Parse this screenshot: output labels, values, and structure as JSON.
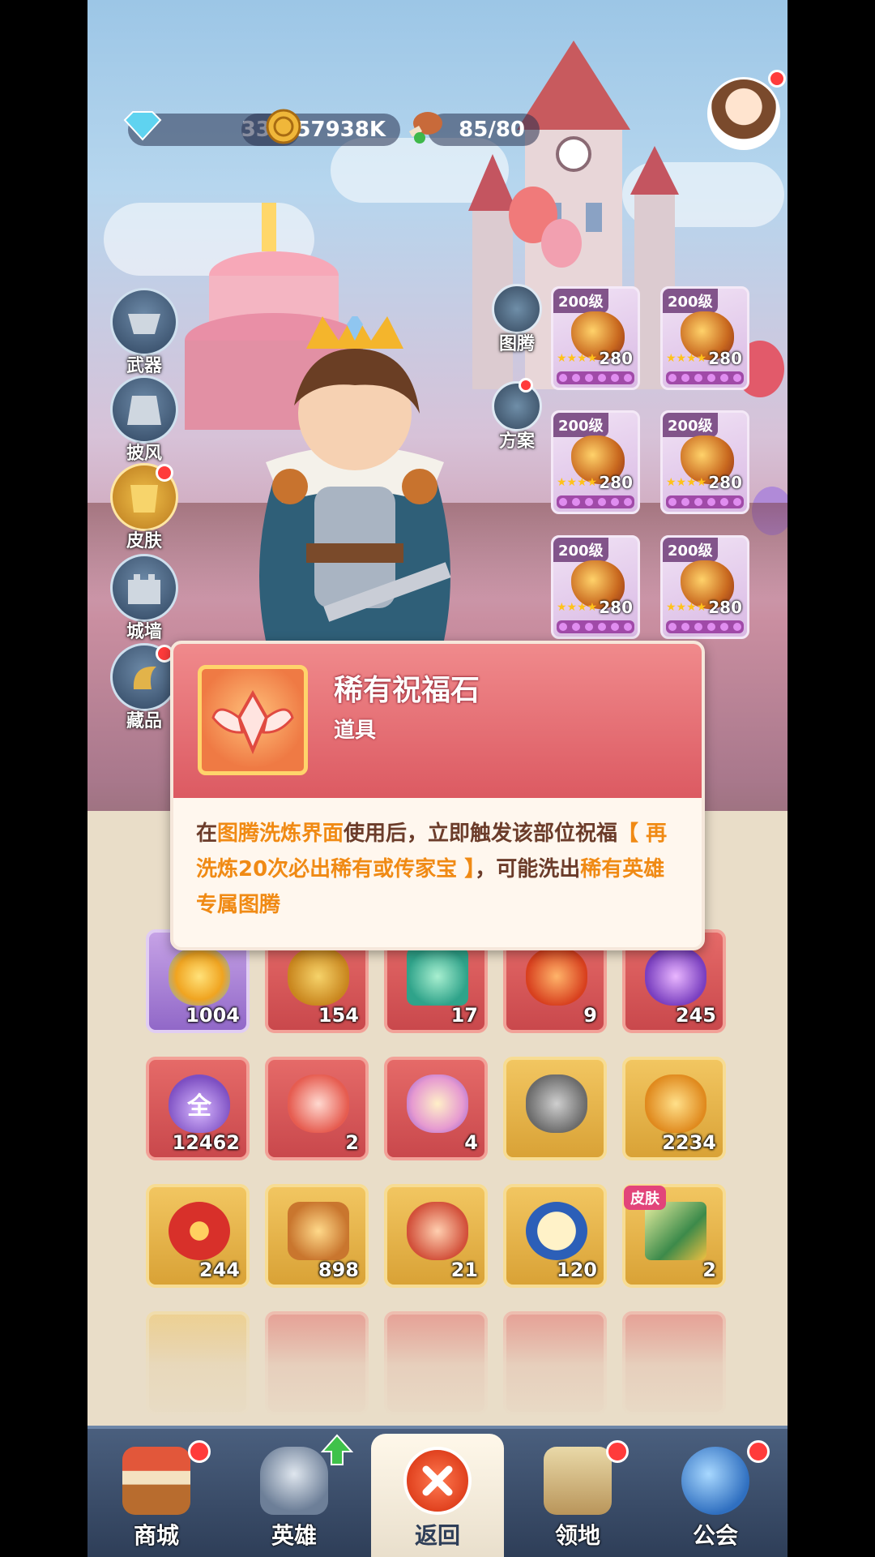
{
  "resources": {
    "diamonds": "330",
    "gold": "57938K",
    "stamina": "85/80"
  },
  "side_menu": [
    {
      "label": "武器",
      "icon": "weapon-icon",
      "badge": false
    },
    {
      "label": "披风",
      "icon": "cape-icon",
      "badge": false
    },
    {
      "label": "皮肤",
      "icon": "skin-icon",
      "badge": true
    },
    {
      "label": "城墙",
      "icon": "wall-icon",
      "badge": false
    },
    {
      "label": "藏品",
      "icon": "collection-icon",
      "badge": true
    }
  ],
  "mid_menu": [
    {
      "label": "图腾",
      "icon": "totem-icon"
    },
    {
      "label": "方案",
      "icon": "plan-icon"
    }
  ],
  "equipment": [
    {
      "level": "200级",
      "power": "280",
      "stars": "★★★★"
    },
    {
      "level": "200级",
      "power": "280",
      "stars": "★★★★"
    },
    {
      "level": "200级",
      "power": "280",
      "stars": "★★★★"
    },
    {
      "level": "200级",
      "power": "280",
      "stars": "★★★★"
    },
    {
      "level": "200级",
      "power": "280",
      "stars": "★★★★"
    },
    {
      "level": "200级",
      "power": "280",
      "stars": "★★★★"
    }
  ],
  "popup": {
    "title": "稀有祝福石",
    "subtitle": "道具",
    "desc_1": "在",
    "desc_hl_1": "图腾洗炼界面",
    "desc_2": "使用后，立即触发该部位祝福",
    "desc_hl_2": "【 再洗炼20次必出稀有或传家宝 】",
    "desc_3": "，可能洗出",
    "desc_hl_3": "稀有英雄专属图腾"
  },
  "inventory": [
    {
      "count": "1004",
      "style": "purple",
      "icon": "star-gem-icon"
    },
    {
      "count": "154",
      "style": "red",
      "icon": "magic-lamp-icon"
    },
    {
      "count": "17",
      "style": "red",
      "icon": "ticket-icon"
    },
    {
      "count": "9",
      "style": "red",
      "icon": "flame-crystal-icon"
    },
    {
      "count": "245",
      "style": "red",
      "icon": "purple-crystal-icon"
    },
    {
      "count": "12462",
      "style": "red",
      "icon": "drop-all-icon",
      "glyph": "全"
    },
    {
      "count": "2",
      "style": "red",
      "icon": "blessing-stone-icon"
    },
    {
      "count": "4",
      "style": "red",
      "icon": "shell-icon"
    },
    {
      "count": "",
      "style": "gold",
      "icon": "cat-statue-icon"
    },
    {
      "count": "2234",
      "style": "gold",
      "icon": "amber-stone-icon"
    },
    {
      "count": "244",
      "style": "gold",
      "icon": "chip-icon"
    },
    {
      "count": "898",
      "style": "gold",
      "icon": "hammer-icon"
    },
    {
      "count": "21",
      "style": "gold",
      "icon": "ore-icon"
    },
    {
      "count": "120",
      "style": "gold",
      "icon": "cat-coin-icon"
    },
    {
      "count": "2",
      "style": "gold",
      "icon": "sword-skin-icon",
      "tag": "皮肤"
    }
  ],
  "nav": [
    {
      "label": "商城",
      "icon": "shop-icon",
      "badge": true
    },
    {
      "label": "英雄",
      "icon": "hero-helmet-icon",
      "badge": false
    },
    {
      "label": "返回",
      "icon": "close-icon",
      "badge": false
    },
    {
      "label": "领地",
      "icon": "territory-castle-icon",
      "badge": true
    },
    {
      "label": "公会",
      "icon": "guild-planet-icon",
      "badge": true
    }
  ],
  "colors": {
    "highlight": "#f08a14",
    "popup_header": "#dc5a62",
    "popup_text": "#6b3c2a",
    "navbar": "#2e3e58"
  }
}
